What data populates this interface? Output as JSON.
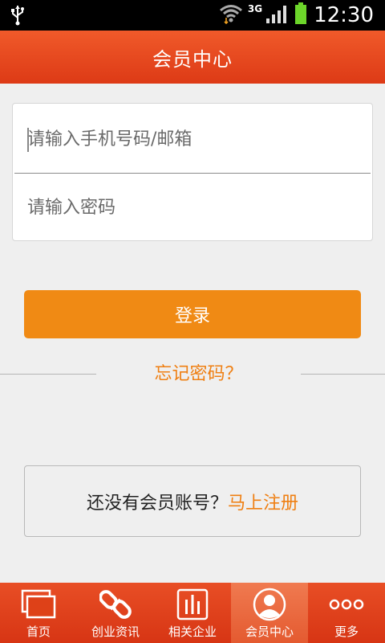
{
  "status_bar": {
    "network": "3G",
    "time": "12:30"
  },
  "header": {
    "title": "会员中心"
  },
  "login_form": {
    "account_placeholder": "请输入手机号码/邮箱",
    "password_placeholder": "请输入密码"
  },
  "login_button": {
    "label": "登录"
  },
  "forgot_password": {
    "label": "忘记密码？"
  },
  "register": {
    "prompt": "还没有会员账号？",
    "link": "马上注册"
  },
  "bottom_nav": {
    "items": [
      {
        "label": "首页",
        "icon": "home-icon"
      },
      {
        "label": "创业资讯",
        "icon": "link-icon"
      },
      {
        "label": "相关企业",
        "icon": "bar-chart-icon"
      },
      {
        "label": "会员中心",
        "icon": "user-icon",
        "active": true
      },
      {
        "label": "更多",
        "icon": "more-icon"
      }
    ]
  },
  "colors": {
    "brand_red": "#dd3a16",
    "accent_orange": "#f08a14",
    "link_orange": "#ef7f12"
  }
}
